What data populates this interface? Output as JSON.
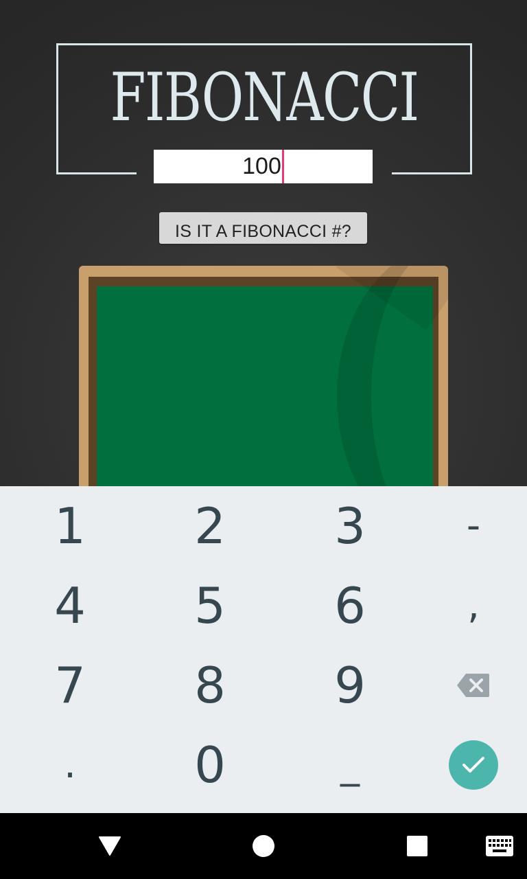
{
  "app": {
    "title": "FIBONACCI",
    "input_value": "100",
    "check_button_label": "IS IT A FIBONACCI #?"
  },
  "keyboard": {
    "rows": [
      [
        "1",
        "2",
        "3",
        "-"
      ],
      [
        "4",
        "5",
        "6",
        ","
      ],
      [
        "7",
        "8",
        "9",
        "backspace-icon"
      ],
      [
        ".",
        "0",
        "_",
        "done-icon"
      ]
    ]
  },
  "navbar": {
    "buttons": [
      "back-icon",
      "home-icon",
      "recents-icon",
      "keyboard-switch-icon"
    ]
  },
  "colors": {
    "background": "#2c2c2c",
    "title": "#dde9ec",
    "caret": "#e6397c",
    "chalkboard_green": "#01703e",
    "chalkboard_wood": "#c9a06c",
    "keyboard_bg": "#eaeef1",
    "key_text": "#37474f",
    "done_accent": "#4db6ac"
  }
}
